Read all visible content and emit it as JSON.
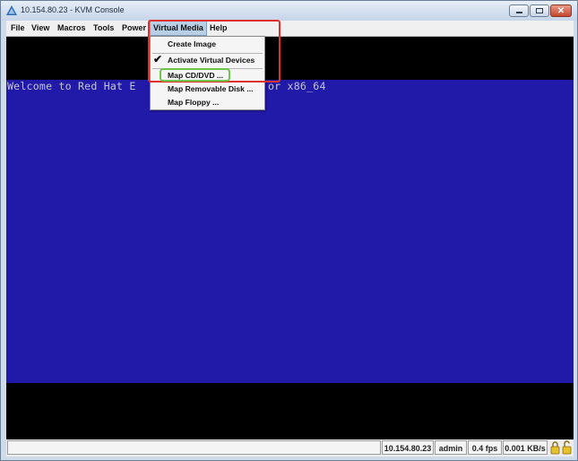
{
  "window": {
    "title": "10.154.80.23 - KVM Console"
  },
  "menubar": {
    "items": [
      "File",
      "View",
      "Macros",
      "Tools",
      "Power",
      "Virtual Media",
      "Help"
    ],
    "active": "Virtual Media"
  },
  "console": {
    "visible_text_left": "Welcome to Red Hat E",
    "visible_text_right": "or x86_64"
  },
  "virtual_media_menu": {
    "items": [
      {
        "label": "Create Image",
        "checked": false
      },
      {
        "label": "Activate Virtual Devices",
        "checked": true
      },
      {
        "label": "Map CD/DVD ...",
        "checked": false,
        "highlighted": true
      },
      {
        "label": "Map Removable Disk ...",
        "checked": false
      },
      {
        "label": "Map Floppy ...",
        "checked": false
      }
    ]
  },
  "statusbar": {
    "message": "",
    "host": "10.154.80.23",
    "user": "admin",
    "fps": "0.4 fps",
    "rate": "0.001 KB/s"
  },
  "colors": {
    "console_blue": "#2119a8",
    "annotation_red": "#e0302e",
    "annotation_green": "#6cc64a"
  },
  "icons": {
    "title": "kvm-triangle-icon",
    "check": "checkmark-icon",
    "lock_closed": "lock-closed-icon",
    "lock_open": "lock-open-icon"
  }
}
